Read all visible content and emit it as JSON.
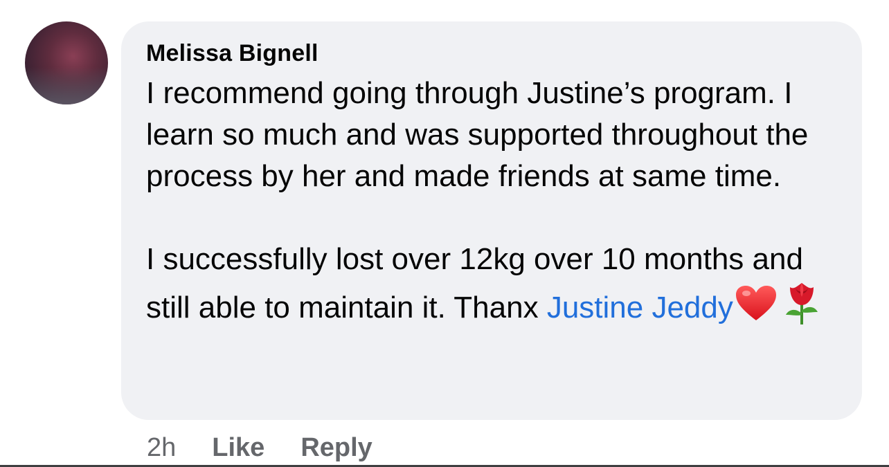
{
  "comment": {
    "author": "Melissa Bignell",
    "paragraph1": "I recommend going through Justine’s program. I learn so much and was supported throughout the process by her and made friends at same time.",
    "paragraph2_text": "I successfully lost over 12kg over 10 months and still able to maintain it. Thanx ",
    "mention": "Justine Jeddy",
    "emojis": [
      "heart-icon",
      "rose-icon"
    ]
  },
  "actions": {
    "time": "2h",
    "like_label": "Like",
    "reply_label": "Reply"
  },
  "colors": {
    "bubble": "#f0f1f4",
    "mention": "#216fdb",
    "meta": "#65676b",
    "text": "#050505"
  }
}
